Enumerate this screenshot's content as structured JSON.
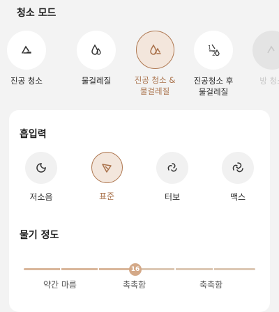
{
  "cleaning_mode": {
    "title": "청소 모드",
    "items": [
      {
        "label": "진공 청소",
        "icon": "vacuum-icon",
        "selected": false
      },
      {
        "label": "물걸레질",
        "icon": "water-drop-icon",
        "selected": false
      },
      {
        "label": "진공 청소 & 물걸레질",
        "icon": "vacuum-mop-icon",
        "selected": true
      },
      {
        "label": "진공청소 후 물걸레질",
        "icon": "vacuum-then-mop-icon",
        "selected": false
      },
      {
        "label": "방 청소",
        "icon": "room-clean-icon",
        "selected": false
      }
    ]
  },
  "suction": {
    "title": "흡입력",
    "items": [
      {
        "label": "저소음",
        "icon": "quiet-icon",
        "selected": false
      },
      {
        "label": "표준",
        "icon": "standard-fan-icon",
        "selected": true
      },
      {
        "label": "터보",
        "icon": "turbo-fan-icon",
        "selected": false
      },
      {
        "label": "맥스",
        "icon": "max-fan-icon",
        "selected": false
      }
    ]
  },
  "water_level": {
    "title": "물기 정도",
    "value": "16",
    "labels": [
      "약간 마름",
      "촉촉함",
      "축축함"
    ]
  },
  "colors": {
    "accent": "#b07a54",
    "accent_light": "#f3e6dc",
    "slider_fill": "#d4a988",
    "background": "#f3f3f3"
  }
}
